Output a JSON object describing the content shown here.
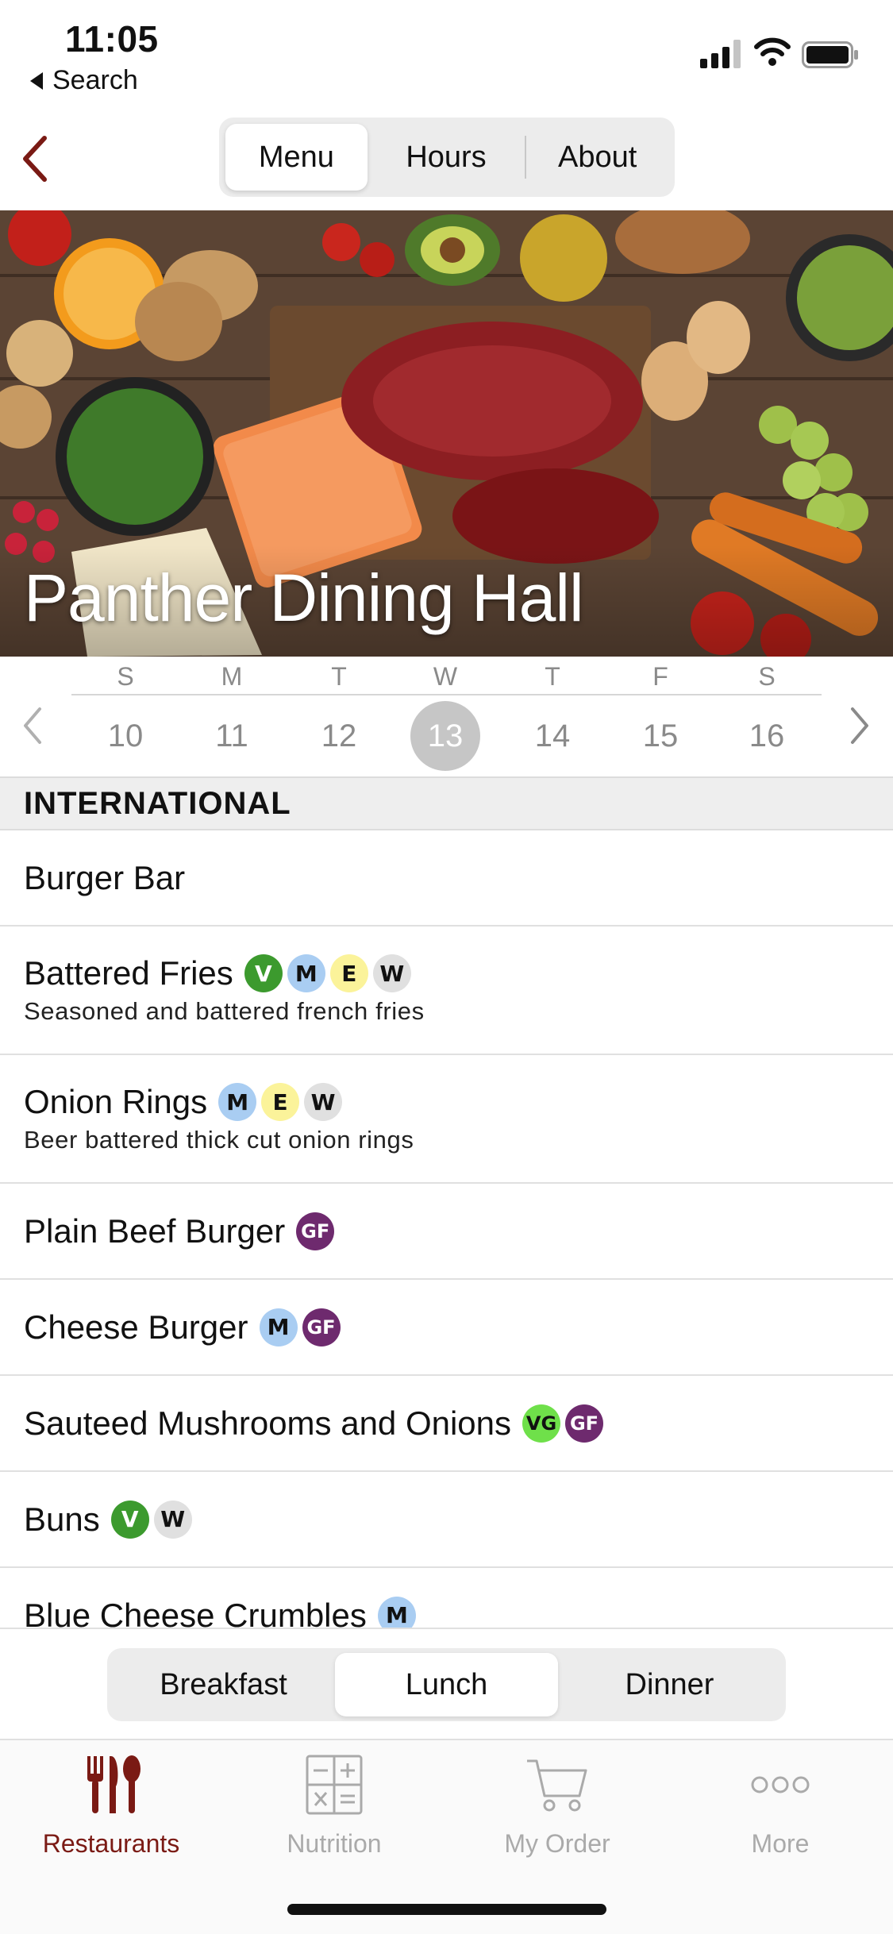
{
  "status_bar": {
    "time": "11:05",
    "back_label": "Search"
  },
  "header": {
    "tabs": [
      {
        "label": "Menu",
        "active": true
      },
      {
        "label": "Hours",
        "active": false
      },
      {
        "label": "About",
        "active": false
      }
    ]
  },
  "hero": {
    "title": "Panther Dining Hall"
  },
  "week": {
    "days": [
      {
        "dow": "S",
        "num": "10"
      },
      {
        "dow": "M",
        "num": "11"
      },
      {
        "dow": "T",
        "num": "12"
      },
      {
        "dow": "W",
        "num": "13",
        "selected": true
      },
      {
        "dow": "T",
        "num": "14"
      },
      {
        "dow": "F",
        "num": "15"
      },
      {
        "dow": "S",
        "num": "16"
      }
    ]
  },
  "menu": {
    "section": "INTERNATIONAL",
    "items": [
      {
        "name": "Burger Bar",
        "desc": "",
        "badges": []
      },
      {
        "name": "Battered Fries",
        "desc": "Seasoned and battered french fries",
        "badges": [
          "V",
          "M",
          "E",
          "W"
        ]
      },
      {
        "name": "Onion Rings",
        "desc": "Beer battered thick cut onion rings",
        "badges": [
          "M",
          "E",
          "W"
        ]
      },
      {
        "name": "Plain Beef Burger",
        "desc": "",
        "badges": [
          "GF"
        ]
      },
      {
        "name": "Cheese Burger",
        "desc": "",
        "badges": [
          "M",
          "GF"
        ]
      },
      {
        "name": "Sauteed Mushrooms and Onions",
        "desc": "",
        "badges": [
          "VG",
          "GF"
        ]
      },
      {
        "name": "Buns",
        "desc": "",
        "badges": [
          "V",
          "W"
        ]
      },
      {
        "name": "Blue Cheese Crumbles",
        "desc": "",
        "badges": [
          "M"
        ]
      }
    ],
    "badge_colors": {
      "V": {
        "bg": "#3c9a2e",
        "fg": "#ffffff"
      },
      "M": {
        "bg": "#a9cdf2",
        "fg": "#111111"
      },
      "E": {
        "bg": "#fbf39a",
        "fg": "#111111"
      },
      "W": {
        "bg": "#e0e0e0",
        "fg": "#111111"
      },
      "GF": {
        "bg": "#6e2a6e",
        "fg": "#ffffff"
      },
      "VG": {
        "bg": "#6fe04a",
        "fg": "#111111"
      }
    }
  },
  "meal_selector": {
    "options": [
      {
        "label": "Breakfast",
        "active": false
      },
      {
        "label": "Lunch",
        "active": true
      },
      {
        "label": "Dinner",
        "active": false
      }
    ]
  },
  "tab_bar": {
    "items": [
      {
        "label": "Restaurants",
        "icon": "fork-knife-spoon-icon",
        "active": true
      },
      {
        "label": "Nutrition",
        "icon": "calculator-icon",
        "active": false
      },
      {
        "label": "My Order",
        "icon": "cart-icon",
        "active": false
      },
      {
        "label": "More",
        "icon": "more-dots-icon",
        "active": false
      }
    ]
  },
  "colors": {
    "accent": "#7a1a14",
    "inactive": "#aaaaaa"
  }
}
